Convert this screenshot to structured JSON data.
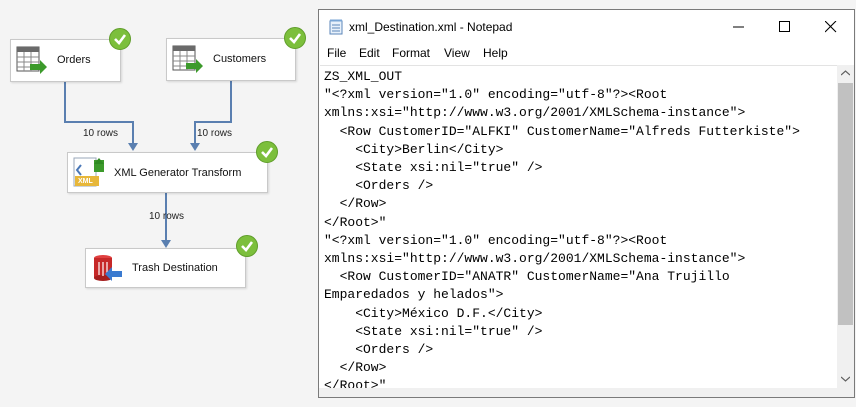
{
  "dataflow": {
    "nodes": {
      "orders": {
        "label": "Orders"
      },
      "customers": {
        "label": "Customers"
      },
      "xml_transform": {
        "label": "XML Generator Transform",
        "icon_text": "XML"
      },
      "trash": {
        "label": "Trash Destination"
      }
    },
    "paths": {
      "orders_to_xml": "10 rows",
      "customers_to_xml": "10 rows",
      "xml_to_trash": "10 rows"
    },
    "colors": {
      "success": "#7cbf3c",
      "path": "#5a7fb0"
    }
  },
  "notepad": {
    "title": "xml_Destination.xml - Notepad",
    "menu": [
      "File",
      "Edit",
      "Format",
      "View",
      "Help"
    ],
    "content": "ZS_XML_OUT\n\"<?xml version=\"1.0\" encoding=\"utf-8\"?><Root\nxmlns:xsi=\"http://www.w3.org/2001/XMLSchema-instance\">\n  <Row CustomerID=\"ALFKI\" CustomerName=\"Alfreds Futterkiste\">\n    <City>Berlin</City>\n    <State xsi:nil=\"true\" />\n    <Orders />\n  </Row>\n</Root>\"\n\"<?xml version=\"1.0\" encoding=\"utf-8\"?><Root\nxmlns:xsi=\"http://www.w3.org/2001/XMLSchema-instance\">\n  <Row CustomerID=\"ANATR\" CustomerName=\"Ana Trujillo\nEmparedados y helados\">\n    <City>México D.F.</City>\n    <State xsi:nil=\"true\" />\n    <Orders />\n  </Row>\n</Root>\""
  }
}
